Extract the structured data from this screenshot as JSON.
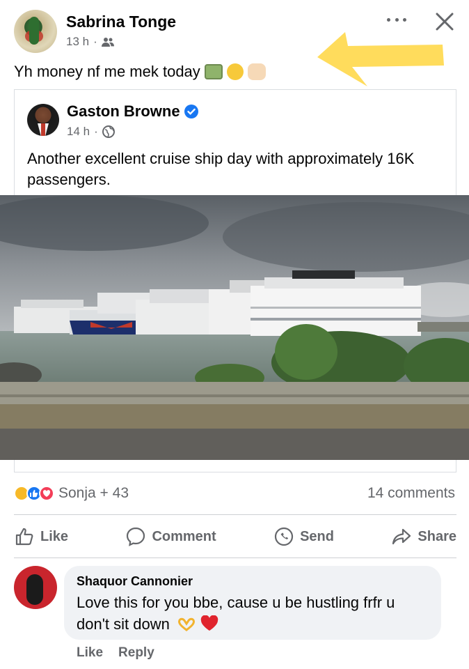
{
  "post": {
    "author": "Sabrina Tonge",
    "time": "13 h",
    "audience_icon": "friends-icon",
    "caption": "Yh money nf me mek today",
    "caption_emojis": [
      "money-bag-emoji",
      "dizzy-face-emoji",
      "raising-hands-emoji"
    ]
  },
  "shared": {
    "author": "Gaston Browne",
    "verified": true,
    "time": "14 h",
    "audience_icon": "globe-icon",
    "text": "Another excellent cruise ship day with approximately 16K passengers."
  },
  "reactions": {
    "summary": "Sonja + 43",
    "types": [
      "care",
      "like",
      "love"
    ],
    "comments_count": "14 comments"
  },
  "actions": {
    "like": "Like",
    "comment": "Comment",
    "send": "Send",
    "share": "Share"
  },
  "comment": {
    "author": "Shaquor Cannonier",
    "text": "Love this for you bbe, cause u be hustling frfr u don't sit down",
    "emojis": [
      "heart-hands-emoji",
      "red-heart-emoji"
    ],
    "like_label": "Like",
    "reply_label": "Reply"
  },
  "colors": {
    "accent": "#1877f2",
    "secondary_text": "#65676b",
    "annotation_arrow": "#ffd84a"
  }
}
